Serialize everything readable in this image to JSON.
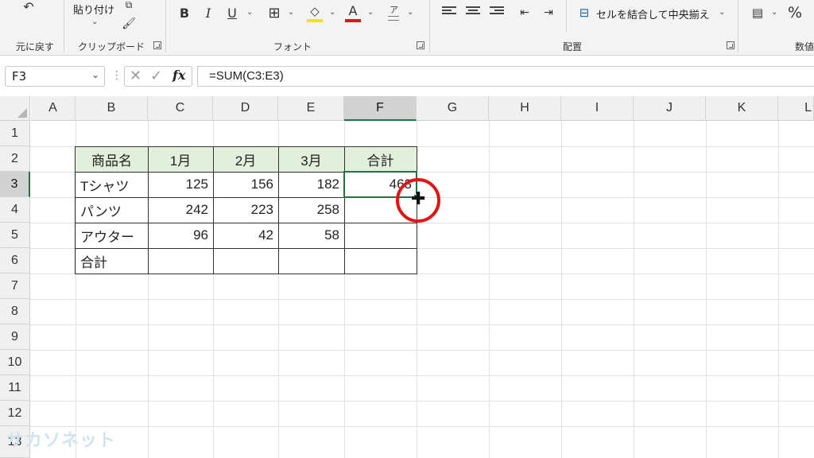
{
  "ribbon": {
    "undo_group_label": "元に戻す",
    "paste_label": "貼り付け",
    "clipboard_label": "クリップボード",
    "font_label": "フォント",
    "alignment_label": "配置",
    "number_label": "数値",
    "merge_center_label": "セルを結合して中央揃え",
    "bold": "B",
    "italic": "I",
    "underline": "U",
    "font_color_glyph": "A",
    "phonetic_glyph": "ア",
    "percent_glyph": "%",
    "accent_font_color": "#e21414",
    "accent_fill_color": "#f5e600"
  },
  "formula_bar": {
    "name_box": "F3",
    "fx": "fx",
    "formula": "=SUM(C3:E3)"
  },
  "columns": [
    "A",
    "B",
    "C",
    "D",
    "E",
    "F",
    "G",
    "H",
    "I",
    "J",
    "K",
    "L"
  ],
  "rows": [
    "1",
    "2",
    "3",
    "4",
    "5",
    "6",
    "7",
    "8",
    "9",
    "10",
    "11",
    "12",
    "13"
  ],
  "table": {
    "headers": [
      "商品名",
      "1月",
      "2月",
      "3月",
      "合計"
    ],
    "rows": [
      {
        "name": "Tシャツ",
        "m1": "125",
        "m2": "156",
        "m3": "182",
        "total": "463"
      },
      {
        "name": "パンツ",
        "m1": "242",
        "m2": "223",
        "m3": "258",
        "total": ""
      },
      {
        "name": "アウター",
        "m1": "96",
        "m2": "42",
        "m3": "58",
        "total": ""
      },
      {
        "name": "合計",
        "m1": "",
        "m2": "",
        "m3": "",
        "total": ""
      }
    ]
  },
  "selection": {
    "cell": "F3",
    "accent": "#217346",
    "highlight": "#e21414"
  },
  "watermark": "サカソネット"
}
